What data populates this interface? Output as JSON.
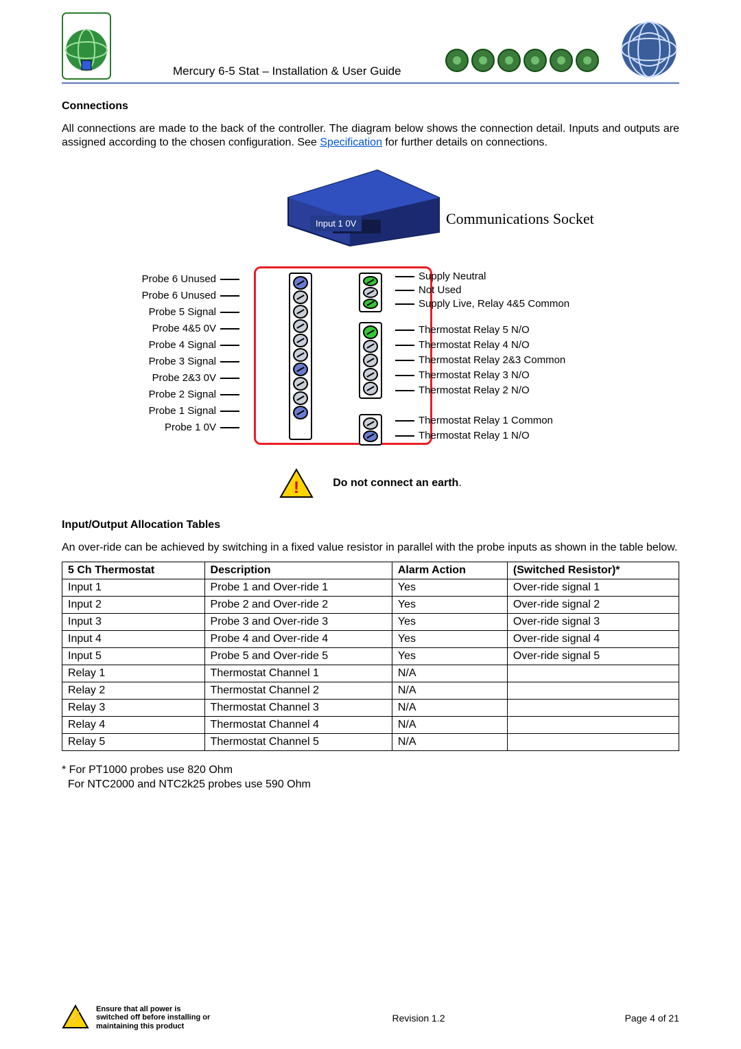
{
  "header": {
    "title": "Mercury 6-5 Stat – Installation & User Guide"
  },
  "sections": {
    "connections_heading": "Connections",
    "connections_body_before_link": "All connections are made to the back of the controller. The diagram below shows the connection detail. Inputs and outputs are assigned according to the chosen configuration. See ",
    "connections_link": "Specification",
    "connections_body_after_link": " for further details on connections.",
    "io_heading": "Input/Output Allocation Tables",
    "io_body": "An over-ride can be achieved by switching in a fixed value resistor in parallel with the probe inputs as shown in the table below."
  },
  "diagram": {
    "comm_socket": "Communications Socket",
    "input_tag": "Input 1 0V",
    "left_labels": [
      "Probe 6 Unused",
      "Probe 6 Unused",
      "Probe 5 Signal",
      "Probe 4&5 0V",
      "Probe 4 Signal",
      "Probe 3 Signal",
      "Probe 2&3 0V",
      "Probe 2 Signal",
      "Probe 1 Signal",
      "Probe 1 0V"
    ],
    "right_group1": [
      "Supply Neutral",
      "Not Used",
      "Supply Live, Relay 4&5 Common"
    ],
    "right_group2": [
      "Thermostat Relay 5 N/O",
      "Thermostat Relay 4 N/O",
      "Thermostat Relay 2&3 Common",
      "Thermostat Relay 3 N/O",
      "Thermostat Relay 2 N/O"
    ],
    "right_group3": [
      "Thermostat Relay 1 Common",
      "Thermostat Relay 1 N/O"
    ]
  },
  "warning": {
    "text": "Do not connect an earth"
  },
  "table": {
    "headers": [
      "5 Ch Thermostat",
      "Description",
      "Alarm Action",
      "(Switched Resistor)*"
    ],
    "rows": [
      [
        "Input 1",
        "Probe 1 and Over-ride 1",
        "Yes",
        "Over-ride signal 1"
      ],
      [
        "Input 2",
        "Probe 2 and Over-ride 2",
        "Yes",
        "Over-ride signal 2"
      ],
      [
        "Input 3",
        "Probe 3 and Over-ride 3",
        "Yes",
        "Over-ride signal 3"
      ],
      [
        "Input 4",
        "Probe 4 and Over-ride 4",
        "Yes",
        "Over-ride signal 4"
      ],
      [
        "Input 5",
        "Probe 5 and Over-ride 5",
        "Yes",
        "Over-ride signal 5"
      ],
      [
        "Relay 1",
        "Thermostat Channel 1",
        "N/A",
        ""
      ],
      [
        "Relay 2",
        "Thermostat Channel 2",
        "N/A",
        ""
      ],
      [
        "Relay 3",
        "Thermostat Channel 3",
        "N/A",
        ""
      ],
      [
        "Relay 4",
        "Thermostat Channel 4",
        "N/A",
        ""
      ],
      [
        "Relay 5",
        "Thermostat Channel 5",
        "N/A",
        ""
      ]
    ]
  },
  "footnote": {
    "line1": "* For PT1000 probes use 820 Ohm",
    "line2": "  For NTC2000 and NTC2k25 probes use 590 Ohm"
  },
  "footer": {
    "warn": "Ensure that all power is switched off before installing or maintaining this product",
    "revision": "Revision 1.2",
    "page": "Page 4 of 21"
  }
}
